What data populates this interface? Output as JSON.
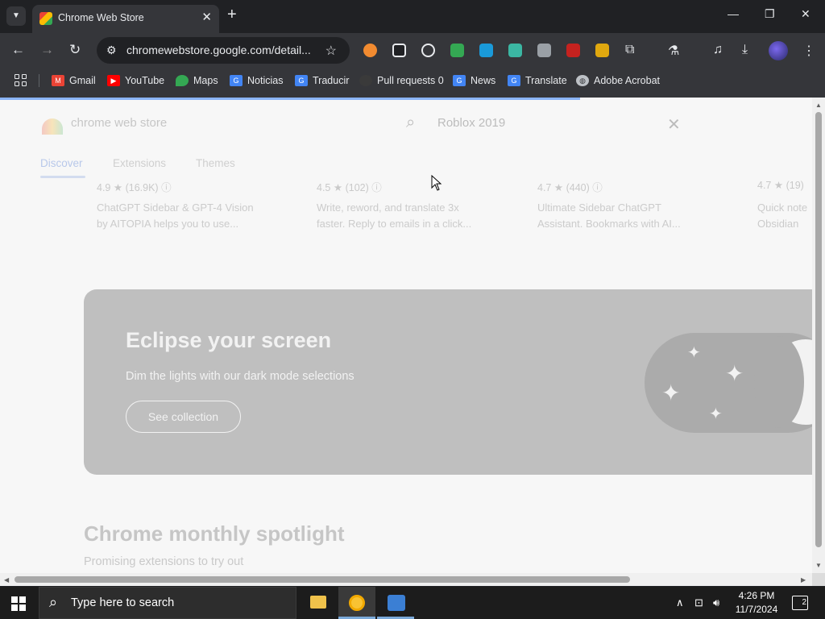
{
  "browser": {
    "tab": {
      "title": "Chrome Web Store"
    },
    "url": "chromewebstore.google.com/detail...",
    "bookmarks": [
      {
        "label": "Gmail",
        "icon": "gmail-icon",
        "color": "#ea4335"
      },
      {
        "label": "YouTube",
        "icon": "youtube-icon",
        "color": "#ff0000"
      },
      {
        "label": "Maps",
        "icon": "maps-icon",
        "color": "#34a853"
      },
      {
        "label": "Noticias",
        "icon": "google-news-icon",
        "color": "#4285f4"
      },
      {
        "label": "Traducir",
        "icon": "google-translate-icon",
        "color": "#4285f4"
      },
      {
        "label": "Pull requests 0",
        "icon": "github-icon",
        "color": "#3a3a3a"
      },
      {
        "label": "News",
        "icon": "google-news-icon",
        "color": "#4285f4"
      },
      {
        "label": "Translate",
        "icon": "google-translate-icon",
        "color": "#4285f4"
      },
      {
        "label": "Adobe Acrobat",
        "icon": "globe-icon",
        "color": "#bdc1c6"
      }
    ]
  },
  "store": {
    "name": "chrome web store",
    "search_value": "Roblox 2019",
    "tabs": [
      "Discover",
      "Extensions",
      "Themes"
    ],
    "active_tab": "Discover",
    "items": [
      {
        "rating": "4.9",
        "count": "(16.9K)",
        "desc1": "ChatGPT Sidebar & GPT-4 Vision",
        "desc2": "by AITOPIA helps you to use..."
      },
      {
        "rating": "4.5",
        "count": "(102)",
        "desc1": "Write, reword, and translate 3x",
        "desc2": "faster. Reply to emails in a click..."
      },
      {
        "rating": "4.7",
        "count": "(440)",
        "desc1": "Ultimate Sidebar ChatGPT",
        "desc2": "Assistant. Bookmarks with AI..."
      },
      {
        "rating": "4.7",
        "count": "(19)",
        "desc1": "Quick note",
        "desc2": "Obsidian"
      }
    ],
    "banner": {
      "title": "Eclipse your screen",
      "subtitle": "Dim the lights with our dark mode selections",
      "button": "See collection"
    },
    "section": {
      "title": "Chrome monthly spotlight",
      "subtitle": "Promising extensions to try out"
    }
  },
  "taskbar": {
    "search_placeholder": "Type here to search",
    "time": "4:26 PM",
    "date": "11/7/2024",
    "notifications": "2"
  }
}
